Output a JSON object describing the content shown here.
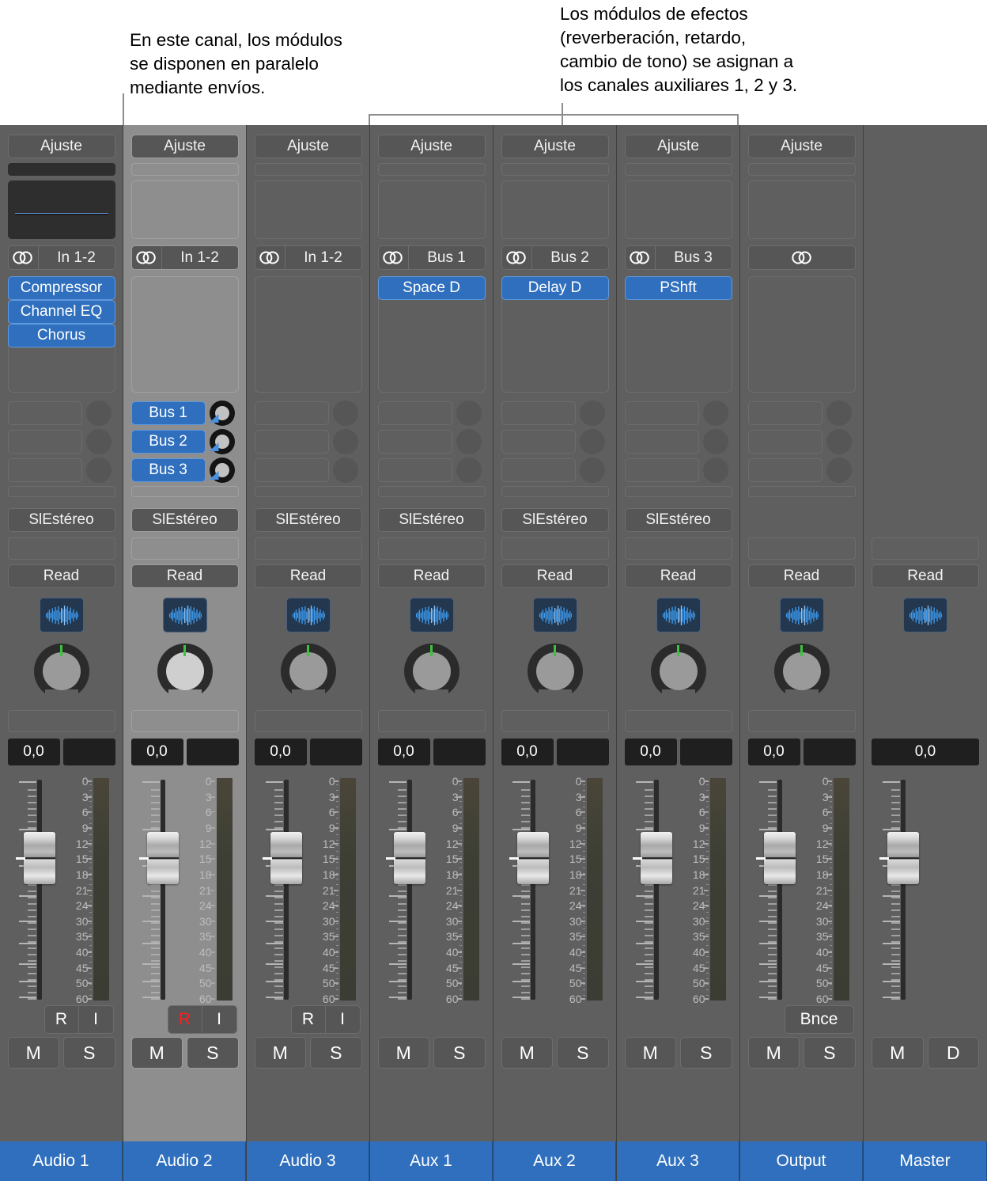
{
  "callouts": {
    "left": "En este canal, los módulos\nse disponen en paralelo\nmediante envíos.",
    "right": "Los módulos de efectos\n(reverberación, retardo,\ncambio de tono) se asignan a\nlos canales auxiliares 1, 2 y 3."
  },
  "labels": {
    "setting": "Ajuste",
    "read": "Read",
    "stereo_out": "SlEstéreo",
    "gain_value": "0,0",
    "rec": "R",
    "input_monitor": "I",
    "bounce": "Bnce",
    "mute": "M",
    "solo": "S",
    "dim": "D",
    "stereo_icon": "stereo-pair-icon",
    "eq_icon": "eq-waveform-icon"
  },
  "meter_scale": [
    "0",
    "3",
    "6",
    "9",
    "12",
    "15",
    "18",
    "21",
    "24",
    "30",
    "35",
    "40",
    "45",
    "50",
    "60"
  ],
  "channels": [
    {
      "name": "Audio 1",
      "selected": false,
      "setting": "Ajuste",
      "has_eq_display": true,
      "io": "In 1-2",
      "io_has_icon": true,
      "plugins": [
        "Compressor",
        "Channel EQ",
        "Chorus"
      ],
      "sends": [],
      "output": "SlEstéreo",
      "automation": "Read",
      "has_eq_icon": true,
      "has_pan": true,
      "gain": "0,0",
      "bottom_buttons": [
        "R",
        "I"
      ],
      "rec_armed": false,
      "ms_buttons": [
        "M",
        "S"
      ],
      "has_meter": true
    },
    {
      "name": "Audio 2",
      "selected": true,
      "setting": "Ajuste",
      "has_eq_display": false,
      "io": "In 1-2",
      "io_has_icon": true,
      "plugins": [],
      "sends": [
        "Bus 1",
        "Bus 2",
        "Bus 3"
      ],
      "output": "SlEstéreo",
      "automation": "Read",
      "has_eq_icon": true,
      "has_pan": true,
      "gain": "0,0",
      "bottom_buttons": [
        "R",
        "I"
      ],
      "rec_armed": true,
      "ms_buttons": [
        "M",
        "S"
      ],
      "has_meter": true
    },
    {
      "name": "Audio 3",
      "selected": false,
      "setting": "Ajuste",
      "has_eq_display": false,
      "io": "In 1-2",
      "io_has_icon": true,
      "plugins": [],
      "sends": [],
      "output": "SlEstéreo",
      "automation": "Read",
      "has_eq_icon": true,
      "has_pan": true,
      "gain": "0,0",
      "bottom_buttons": [
        "R",
        "I"
      ],
      "rec_armed": false,
      "ms_buttons": [
        "M",
        "S"
      ],
      "has_meter": true
    },
    {
      "name": "Aux 1",
      "selected": false,
      "setting": "Ajuste",
      "has_eq_display": false,
      "io": "Bus 1",
      "io_has_icon": true,
      "plugins": [
        "Space D"
      ],
      "sends": [],
      "output": "SlEstéreo",
      "automation": "Read",
      "has_eq_icon": true,
      "has_pan": true,
      "gain": "0,0",
      "bottom_buttons": [],
      "rec_armed": false,
      "ms_buttons": [
        "M",
        "S"
      ],
      "has_meter": true
    },
    {
      "name": "Aux 2",
      "selected": false,
      "setting": "Ajuste",
      "has_eq_display": false,
      "io": "Bus 2",
      "io_has_icon": true,
      "plugins": [
        "Delay D"
      ],
      "sends": [],
      "output": "SlEstéreo",
      "automation": "Read",
      "has_eq_icon": true,
      "has_pan": true,
      "gain": "0,0",
      "bottom_buttons": [],
      "rec_armed": false,
      "ms_buttons": [
        "M",
        "S"
      ],
      "has_meter": true
    },
    {
      "name": "Aux 3",
      "selected": false,
      "setting": "Ajuste",
      "has_eq_display": false,
      "io": "Bus 3",
      "io_has_icon": true,
      "plugins": [
        "PShft"
      ],
      "sends": [],
      "output": "SlEstéreo",
      "automation": "Read",
      "has_eq_icon": true,
      "has_pan": true,
      "gain": "0,0",
      "bottom_buttons": [],
      "rec_armed": false,
      "ms_buttons": [
        "M",
        "S"
      ],
      "has_meter": true
    },
    {
      "name": "Output",
      "selected": false,
      "setting": "Ajuste",
      "has_eq_display": false,
      "io": "",
      "io_has_icon": true,
      "plugins": [],
      "sends": [],
      "output": "",
      "automation": "Read",
      "has_eq_icon": true,
      "has_pan": true,
      "gain": "0,0",
      "bottom_buttons": [
        "Bnce"
      ],
      "rec_armed": false,
      "ms_buttons": [
        "M",
        "S"
      ],
      "has_meter": true
    },
    {
      "name": "Master",
      "selected": false,
      "setting": "",
      "has_eq_display": false,
      "io": "",
      "io_has_icon": false,
      "plugins": [],
      "sends": [],
      "output": "",
      "automation": "Read",
      "has_eq_icon": true,
      "has_pan": false,
      "gain": "0,0",
      "bottom_buttons": [],
      "rec_armed": false,
      "ms_buttons": [
        "M",
        "D"
      ],
      "has_meter": false
    }
  ],
  "colors": {
    "plugin_blue": "#2f6fbd",
    "name_blue": "#2f6fbd",
    "record_red": "#ff1d1d",
    "pan_tick_green": "#3ec13e",
    "strip_bg": "#5f5f5f",
    "strip_bg_selected": "#8e8e8e"
  }
}
